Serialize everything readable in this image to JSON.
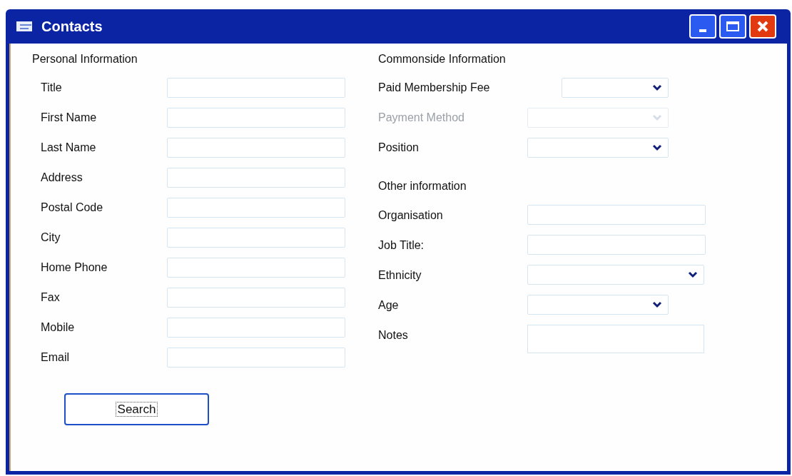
{
  "window": {
    "title": "Contacts"
  },
  "personal": {
    "heading": "Personal Information",
    "fields": [
      {
        "label": "Title",
        "kind": "text"
      },
      {
        "label": "First Name",
        "kind": "text"
      },
      {
        "label": "Last Name",
        "kind": "text"
      },
      {
        "label": "Address",
        "kind": "text"
      },
      {
        "label": "Postal Code",
        "kind": "text"
      },
      {
        "label": "City",
        "kind": "text"
      },
      {
        "label": "Home Phone",
        "kind": "text"
      },
      {
        "label": "Fax",
        "kind": "text"
      },
      {
        "label": "Mobile",
        "kind": "text"
      },
      {
        "label": "Email",
        "kind": "text"
      }
    ]
  },
  "commonside": {
    "heading": "Commonside Information",
    "fields": [
      {
        "label": "Paid Membership Fee",
        "kind": "short-dropdown",
        "disabled": false
      },
      {
        "label": "Payment Method",
        "kind": "dropdown",
        "disabled": true
      },
      {
        "label": "Position",
        "kind": "dropdown",
        "disabled": false
      }
    ]
  },
  "other": {
    "heading": "Other information",
    "fields": [
      {
        "label": "Organisation",
        "kind": "text",
        "disabled": false
      },
      {
        "label": "Job Title:",
        "kind": "text",
        "disabled": false
      },
      {
        "label": "Ethnicity",
        "kind": "wide-dropdown",
        "disabled": false
      },
      {
        "label": "Age",
        "kind": "dropdown",
        "disabled": false
      },
      {
        "label": "Notes",
        "kind": "notes",
        "disabled": false
      }
    ]
  },
  "search_button": "Search"
}
